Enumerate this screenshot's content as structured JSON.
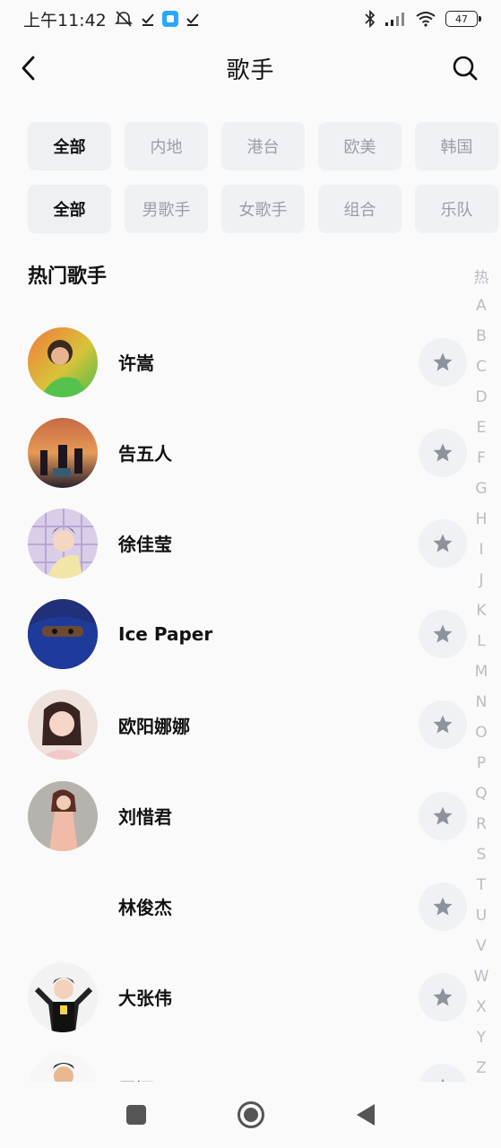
{
  "status_bar": {
    "time": "上午11:42",
    "battery": "47"
  },
  "header": {
    "title": "歌手"
  },
  "region_filters": [
    "全部",
    "内地",
    "港台",
    "欧美",
    "韩国"
  ],
  "type_filters": [
    "全部",
    "男歌手",
    "女歌手",
    "组合",
    "乐队"
  ],
  "section_title": "热门歌手",
  "singers": [
    {
      "name": "许嵩"
    },
    {
      "name": "告五人"
    },
    {
      "name": "徐佳莹"
    },
    {
      "name": "Ice Paper"
    },
    {
      "name": "欧阳娜娜"
    },
    {
      "name": "刘惜君"
    },
    {
      "name": "林俊杰"
    },
    {
      "name": "大张伟"
    },
    {
      "name": "周深"
    }
  ],
  "index_letters": [
    "热",
    "A",
    "B",
    "C",
    "D",
    "E",
    "F",
    "G",
    "H",
    "I",
    "J",
    "K",
    "L",
    "M",
    "N",
    "O",
    "P",
    "Q",
    "R",
    "S",
    "T",
    "U",
    "V",
    "W",
    "X",
    "Y",
    "Z"
  ],
  "colors": {
    "chip_bg": "#f0f1f4",
    "chip_text": "#9b9ea5",
    "active_text": "#111111",
    "star": "#8e939b"
  }
}
